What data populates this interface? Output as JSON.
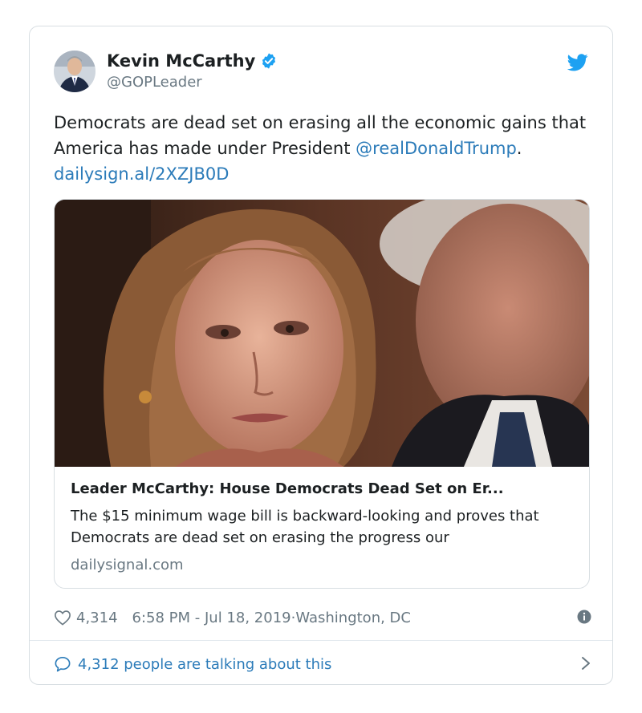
{
  "tweet": {
    "author_name": "Kevin McCarthy",
    "author_handle": "@GOPLeader",
    "text_intro": "Democrats are dead set on erasing all the economic gains that America has made under President ",
    "mention": "@realDonaldTrump",
    "text_sep": ". ",
    "link": "dailysign.al/2XZJB0D",
    "card": {
      "title": "Leader McCarthy: House Democrats Dead Set on Er...",
      "description": "The $15 minimum wage bill is backward-looking and proves that Democrats are dead set on erasing the progress our",
      "domain": "dailysignal.com"
    },
    "likes": "4,314",
    "timestamp": "6:58 PM - Jul 18, 2019",
    "location_sep": " · ",
    "location": "Washington, DC",
    "talking": "4,312 people are talking about this"
  },
  "icons": {
    "verified": "verified-badge-icon",
    "brand": "twitter-bird-icon",
    "like": "heart-icon",
    "info": "info-icon",
    "reply": "speech-bubble-icon",
    "more": "chevron-right-icon"
  },
  "colors": {
    "link": "#2b7bb9",
    "twitter_blue": "#1da1f2",
    "muted": "#697882",
    "text": "#1c2022",
    "border": "#d8dee2"
  }
}
